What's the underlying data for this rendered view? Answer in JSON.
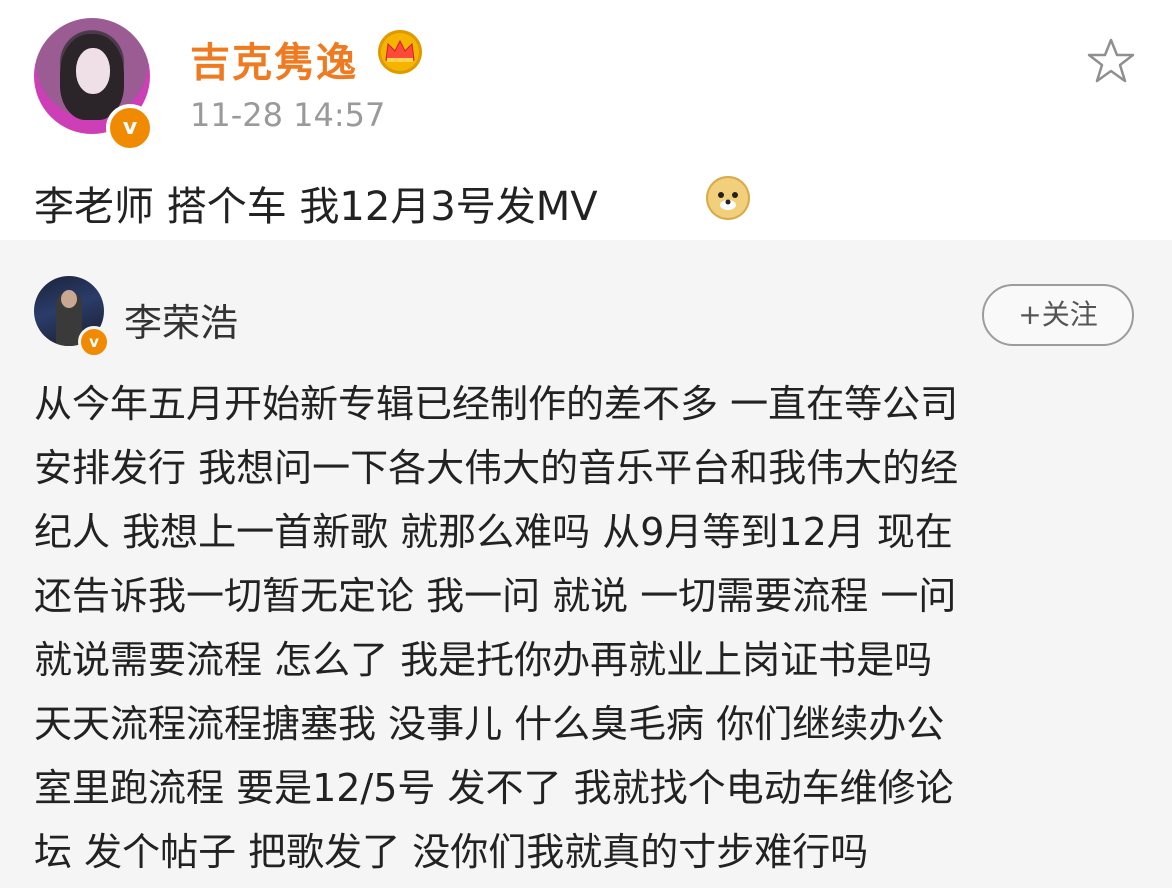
{
  "post": {
    "author": "吉克隽逸",
    "timestamp": "11-28 14:57",
    "text": "李老师 搭个车 我12月3号发MV",
    "icons": [
      "crown-icon",
      "star-icon",
      "doge-emoji-icon",
      "verified-badge-icon"
    ],
    "accent_color": "#f07a20"
  },
  "repost": {
    "author": "李荣浩",
    "follow_label": "+关注",
    "lines": [
      "从今年五月开始新专辑已经制作的差不多 一直在等公司",
      "安排发行 我想问一下各大伟大的音乐平台和我伟大的经",
      "纪人 我想上一首新歌 就那么难吗 从9月等到12月  现在",
      "还告诉我一切暂无定论 我一问 就说 一切需要流程 一问",
      "就说需要流程 怎么了 我是托你办再就业上岗证书是吗",
      "天天流程流程搪塞我  没事儿 什么臭毛病 你们继续办公",
      "室里跑流程 要是12/5号 发不了 我就找个电动车维修论",
      "坛 发个帖子 把歌发了 没你们我就真的寸步难行吗"
    ]
  }
}
